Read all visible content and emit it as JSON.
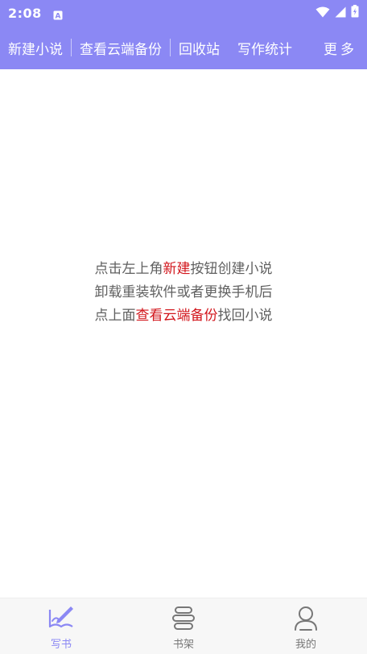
{
  "status_bar": {
    "time": "2:08"
  },
  "top_menu": {
    "items": [
      "新建小说",
      "查看云端备份",
      "回收站",
      "写作统计"
    ],
    "more": "更多"
  },
  "hint": {
    "line1": {
      "pre": "点击左上角",
      "highlight": "新建",
      "post": "按钮创建小说"
    },
    "line2": "卸载重装软件或者更换手机后",
    "line3": {
      "pre": "点上面",
      "highlight": "查看云端备份",
      "post": "找回小说"
    }
  },
  "bottom_nav": {
    "tabs": [
      {
        "label": "写书",
        "icon": "write-book-icon",
        "active": true
      },
      {
        "label": "书架",
        "icon": "bookshelf-icon",
        "active": false
      },
      {
        "label": "我的",
        "icon": "profile-icon",
        "active": false
      }
    ]
  },
  "colors": {
    "accent": "#8b88f4",
    "highlight": "#d2161c",
    "hint_text": "#606060"
  }
}
